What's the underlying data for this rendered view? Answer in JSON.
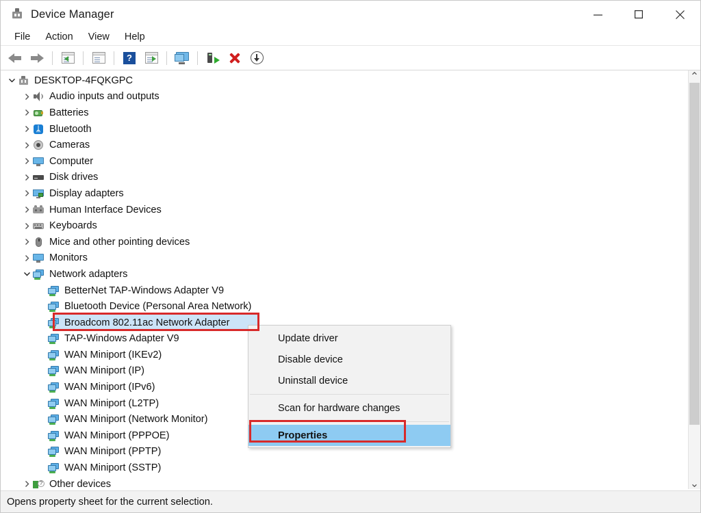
{
  "window": {
    "title": "Device Manager",
    "icon": "device-manager-icon",
    "controls": {
      "minimize": "—",
      "maximize": "☐",
      "close": "✕"
    }
  },
  "menubar": {
    "items": [
      {
        "label": "File"
      },
      {
        "label": "Action"
      },
      {
        "label": "View"
      },
      {
        "label": "Help"
      }
    ]
  },
  "toolbar": {
    "buttons": [
      {
        "name": "back-button",
        "icon": "back-arrow-icon"
      },
      {
        "name": "forward-button",
        "icon": "forward-arrow-icon"
      },
      {
        "name": "properties-button",
        "icon": "properties-window-icon"
      },
      {
        "name": "update-driver-button",
        "icon": "driver-window-icon"
      },
      {
        "name": "help-button",
        "icon": "help-question-icon"
      },
      {
        "name": "enable-device-button",
        "icon": "play-window-icon"
      },
      {
        "name": "scan-hardware-button",
        "icon": "monitor-scan-icon"
      },
      {
        "name": "add-legacy-hardware-button",
        "icon": "tower-add-icon"
      },
      {
        "name": "uninstall-device-button",
        "icon": "red-x-icon"
      },
      {
        "name": "install-button",
        "icon": "download-circle-icon"
      }
    ]
  },
  "tree": {
    "root": {
      "label": "DESKTOP-4FQKGPC",
      "icon": "computer-root-icon",
      "expanded": true
    },
    "items": [
      {
        "label": "Audio inputs and outputs",
        "icon": "speaker-icon",
        "level": 1,
        "expandable": true,
        "expanded": false
      },
      {
        "label": "Batteries",
        "icon": "battery-icon",
        "level": 1,
        "expandable": true,
        "expanded": false
      },
      {
        "label": "Bluetooth",
        "icon": "bluetooth-icon",
        "level": 1,
        "expandable": true,
        "expanded": false
      },
      {
        "label": "Cameras",
        "icon": "camera-icon",
        "level": 1,
        "expandable": true,
        "expanded": false
      },
      {
        "label": "Computer",
        "icon": "monitor-icon",
        "level": 1,
        "expandable": true,
        "expanded": false
      },
      {
        "label": "Disk drives",
        "icon": "disk-drive-icon",
        "level": 1,
        "expandable": true,
        "expanded": false
      },
      {
        "label": "Display adapters",
        "icon": "display-adapter-icon",
        "level": 1,
        "expandable": true,
        "expanded": false
      },
      {
        "label": "Human Interface Devices",
        "icon": "hid-icon",
        "level": 1,
        "expandable": true,
        "expanded": false
      },
      {
        "label": "Keyboards",
        "icon": "keyboard-icon",
        "level": 1,
        "expandable": true,
        "expanded": false
      },
      {
        "label": "Mice and other pointing devices",
        "icon": "mouse-icon",
        "level": 1,
        "expandable": true,
        "expanded": false
      },
      {
        "label": "Monitors",
        "icon": "monitor-icon",
        "level": 1,
        "expandable": true,
        "expanded": false
      },
      {
        "label": "Network adapters",
        "icon": "network-adapter-icon",
        "level": 1,
        "expandable": true,
        "expanded": true
      },
      {
        "label": "BetterNet TAP-Windows Adapter V9",
        "icon": "network-adapter-icon",
        "level": 2,
        "expandable": false
      },
      {
        "label": "Bluetooth Device (Personal Area Network)",
        "icon": "network-adapter-icon",
        "level": 2,
        "expandable": false
      },
      {
        "label": "Broadcom 802.11ac Network Adapter",
        "icon": "network-adapter-icon",
        "level": 2,
        "expandable": false,
        "selected": true
      },
      {
        "label": "TAP-Windows Adapter V9",
        "icon": "network-adapter-icon",
        "level": 2,
        "expandable": false
      },
      {
        "label": "WAN Miniport (IKEv2)",
        "icon": "network-adapter-icon",
        "level": 2,
        "expandable": false
      },
      {
        "label": "WAN Miniport (IP)",
        "icon": "network-adapter-icon",
        "level": 2,
        "expandable": false
      },
      {
        "label": "WAN Miniport (IPv6)",
        "icon": "network-adapter-icon",
        "level": 2,
        "expandable": false
      },
      {
        "label": "WAN Miniport (L2TP)",
        "icon": "network-adapter-icon",
        "level": 2,
        "expandable": false
      },
      {
        "label": "WAN Miniport (Network Monitor)",
        "icon": "network-adapter-icon",
        "level": 2,
        "expandable": false
      },
      {
        "label": "WAN Miniport (PPPOE)",
        "icon": "network-adapter-icon",
        "level": 2,
        "expandable": false
      },
      {
        "label": "WAN Miniport (PPTP)",
        "icon": "network-adapter-icon",
        "level": 2,
        "expandable": false
      },
      {
        "label": "WAN Miniport (SSTP)",
        "icon": "network-adapter-icon",
        "level": 2,
        "expandable": false
      },
      {
        "label": "Other devices",
        "icon": "other-devices-warning-icon",
        "level": 1,
        "expandable": true,
        "expanded": false
      }
    ]
  },
  "context_menu": {
    "items": [
      {
        "label": "Update driver",
        "highlight": false
      },
      {
        "label": "Disable device",
        "highlight": false
      },
      {
        "label": "Uninstall device",
        "highlight": false
      },
      {
        "separator": true
      },
      {
        "label": "Scan for hardware changes",
        "highlight": false
      },
      {
        "separator": true
      },
      {
        "label": "Properties",
        "highlight": true
      }
    ]
  },
  "status_bar": {
    "text": "Opens property sheet for the current selection."
  },
  "annotations": {
    "colors": {
      "highlight_box": "#d82a2a",
      "selection": "#cce4f7",
      "menu_highlight": "#8ecbf2"
    }
  },
  "scrollbar": {
    "up_arrow": "⌃",
    "down_arrow": "⌄"
  }
}
